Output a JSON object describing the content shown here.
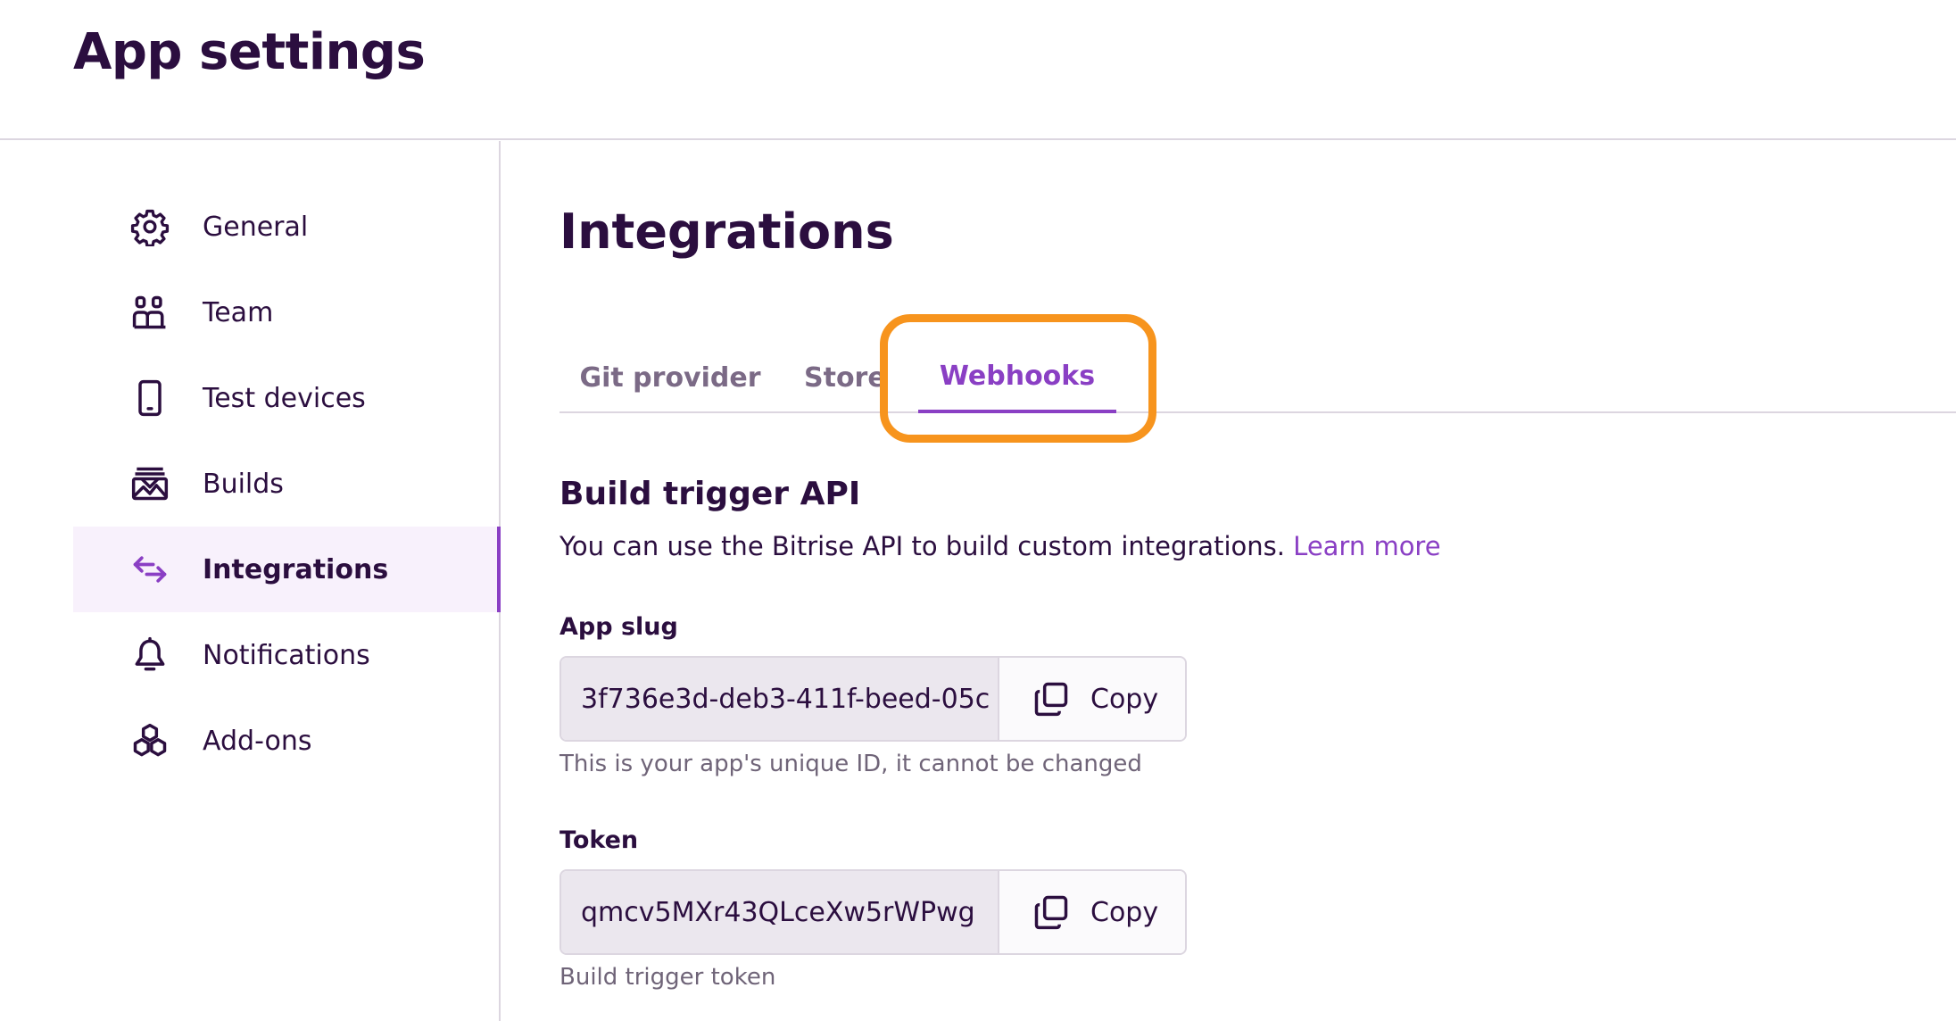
{
  "header": {
    "title": "App settings"
  },
  "sidebar": {
    "items": [
      {
        "label": "General",
        "icon": "gear-icon"
      },
      {
        "label": "Team",
        "icon": "team-icon"
      },
      {
        "label": "Test devices",
        "icon": "phone-icon"
      },
      {
        "label": "Builds",
        "icon": "builds-icon"
      },
      {
        "label": "Integrations",
        "icon": "arrows-exchange-icon",
        "active": true
      },
      {
        "label": "Notifications",
        "icon": "bell-icon"
      },
      {
        "label": "Add-ons",
        "icon": "hexagons-icon"
      }
    ]
  },
  "main": {
    "title": "Integrations",
    "tabs": [
      {
        "label": "Git provider"
      },
      {
        "label": "Stores"
      },
      {
        "label": "Webhooks",
        "active": true
      }
    ],
    "section": {
      "title": "Build trigger API",
      "description": "You can use the Bitrise API to build custom integrations.",
      "link": "Learn more"
    },
    "app_slug": {
      "label": "App slug",
      "value": "3f736e3d-deb3-411f-beed-05c",
      "copy_label": "Copy",
      "helper": "This is your app's unique ID, it cannot be changed"
    },
    "token": {
      "label": "Token",
      "value": "qmcv5MXr43QLceXw5rWPwg",
      "copy_label": "Copy",
      "helper": "Build trigger token"
    }
  },
  "colors": {
    "accent": "#8a3fc4",
    "text": "#2b0e3f",
    "highlight": "#f7941d",
    "active_bg": "#f8f1fc"
  }
}
